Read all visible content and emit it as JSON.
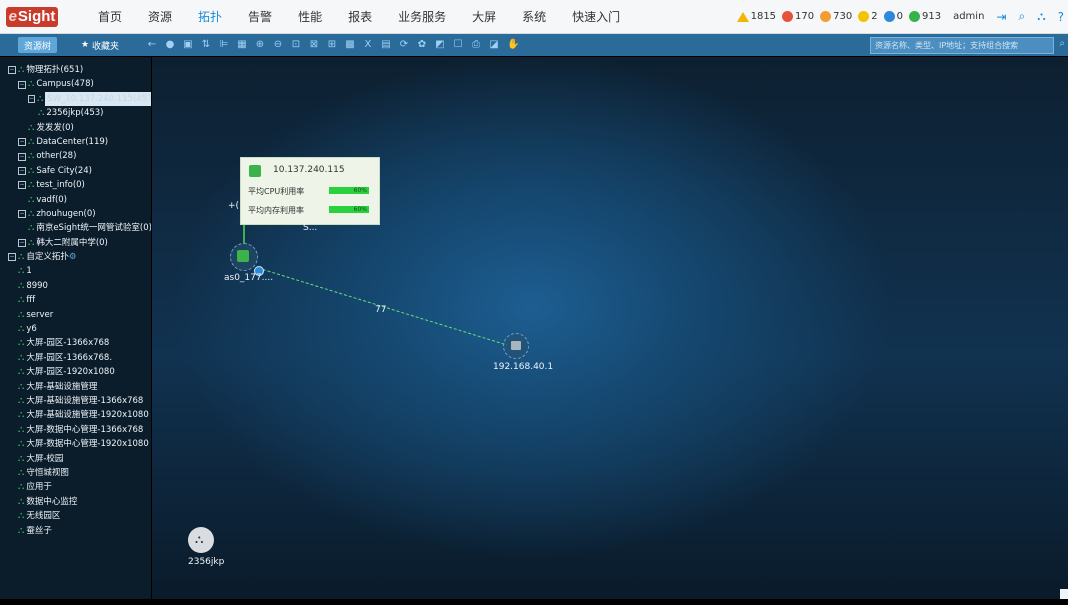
{
  "app": {
    "logo_text_e": "e",
    "logo_text": "Sight"
  },
  "menu": [
    "首页",
    "资源",
    "拓扑",
    "告警",
    "性能",
    "报表",
    "业务服务",
    "大屏",
    "系统",
    "快速入门"
  ],
  "active_menu": "拓扑",
  "alarms": [
    {
      "color": "#f4b400",
      "value": "1815",
      "shape": "triangle"
    },
    {
      "color": "#e5533d",
      "value": "170",
      "shape": "circle"
    },
    {
      "color": "#f39c32",
      "value": "730",
      "shape": "circle"
    },
    {
      "color": "#f2c300",
      "value": "2",
      "shape": "circle"
    },
    {
      "color": "#2e8ad8",
      "value": "0",
      "shape": "circle"
    },
    {
      "color": "#35b34a",
      "value": "913",
      "shape": "circle"
    }
  ],
  "user": "admin",
  "toolbar": {
    "tab_resource": "资源树",
    "tab_fav": "收藏夹",
    "search_placeholder": "资源名称、类型、IP地址；支持组合搜索",
    "tools": [
      "←",
      "●",
      "▣",
      "⇅",
      "⊫",
      "▦",
      "⊕",
      "⊖",
      "⊡",
      "⊠",
      "⊞",
      "▩",
      "X",
      "▤",
      "⟳",
      "✿",
      "◩",
      "☐",
      "⎙",
      "◪",
      "✋"
    ]
  },
  "tree": [
    {
      "label": "物理拓扑(651)",
      "level": 0,
      "exp": true
    },
    {
      "label": "Campus(478)",
      "level": 1,
      "exp": true
    },
    {
      "label": "SW_10.137.240.115(457)",
      "level": 2,
      "exp": true,
      "selected": true
    },
    {
      "label": "2356jkp(453)",
      "level": 3,
      "exp": false
    },
    {
      "label": "发发发(0)",
      "level": 2,
      "exp": false
    },
    {
      "label": "DataCenter(119)",
      "level": 1,
      "exp": true
    },
    {
      "label": "other(28)",
      "level": 1,
      "exp": true
    },
    {
      "label": "Safe City(24)",
      "level": 1,
      "exp": true
    },
    {
      "label": "test_info(0)",
      "level": 1,
      "exp": true
    },
    {
      "label": "vadf(0)",
      "level": 2,
      "exp": false
    },
    {
      "label": "zhouhugen(0)",
      "level": 1,
      "exp": true
    },
    {
      "label": "南京eSight统一网管试验室(0)",
      "level": 2,
      "exp": false
    },
    {
      "label": "韩大二附属中学(0)",
      "level": 1,
      "exp": true
    },
    {
      "label": "自定义拓扑",
      "level": 0,
      "exp": true,
      "gear": true
    },
    {
      "label": "1",
      "level": 1,
      "exp": false
    },
    {
      "label": "8990",
      "level": 1,
      "exp": false
    },
    {
      "label": "fff",
      "level": 1,
      "exp": false
    },
    {
      "label": "server",
      "level": 1,
      "exp": false
    },
    {
      "label": "y6",
      "level": 1,
      "exp": false
    },
    {
      "label": "大屏-园区-1366x768",
      "level": 1,
      "exp": false
    },
    {
      "label": "大屏-园区-1366x768.",
      "level": 1,
      "exp": false
    },
    {
      "label": "大屏-园区-1920x1080",
      "level": 1,
      "exp": false
    },
    {
      "label": "大屏-基础设施管理",
      "level": 1,
      "exp": false
    },
    {
      "label": "大屏-基础设施管理-1366x768",
      "level": 1,
      "exp": false
    },
    {
      "label": "大屏-基础设施管理-1920x1080",
      "level": 1,
      "exp": false
    },
    {
      "label": "大屏-数据中心管理-1366x768",
      "level": 1,
      "exp": false
    },
    {
      "label": "大屏-数据中心管理-1920x1080",
      "level": 1,
      "exp": false
    },
    {
      "label": "大屏-校园",
      "level": 1,
      "exp": false
    },
    {
      "label": "守恒城视图",
      "level": 1,
      "exp": false
    },
    {
      "label": "应用于",
      "level": 1,
      "exp": false
    },
    {
      "label": "数据中心监控",
      "level": 1,
      "exp": false
    },
    {
      "label": "无线园区",
      "level": 1,
      "exp": false
    },
    {
      "label": "蚕丝子",
      "level": 1,
      "exp": false
    }
  ],
  "canvas": {
    "tooltip": {
      "ip": "10.137.240.115",
      "cpu_label": "平均CPU利用率",
      "cpu_value": "60%",
      "mem_label": "平均内存利用率",
      "mem_value": "60%"
    },
    "node1_label": "as0_177....",
    "node1_prefix": "+(",
    "node1_s": "S...",
    "link_label": "77",
    "node2_label": "192.168.40.1",
    "subgraph_label": "2356jkp"
  }
}
